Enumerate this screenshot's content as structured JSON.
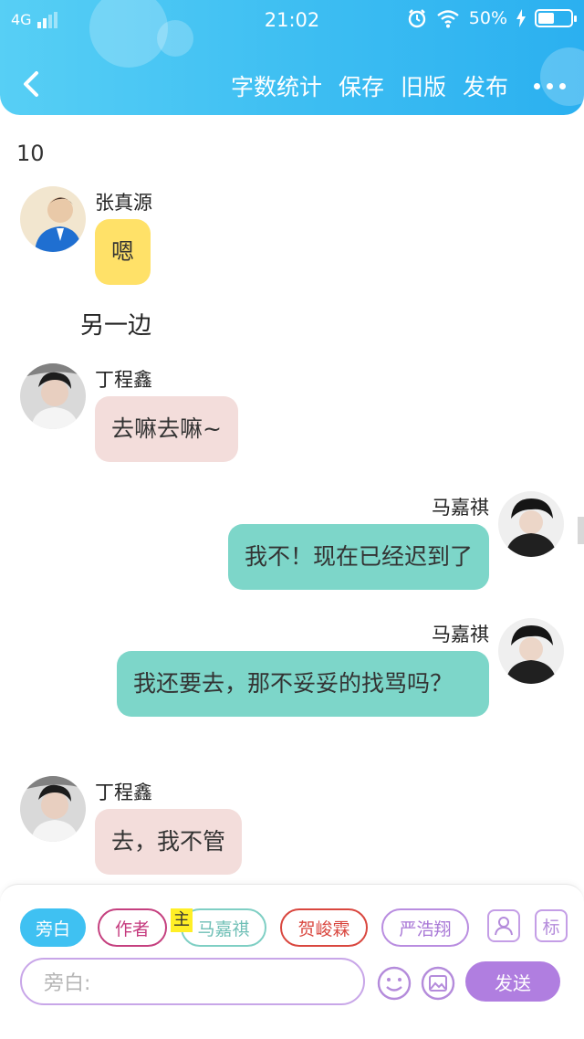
{
  "status_bar": {
    "network": "4G",
    "time": "21:02",
    "battery_percent": "50%",
    "battery_level": 0.5,
    "icons": [
      "alarm-icon",
      "wifi-icon",
      "charging-bolt-icon",
      "battery-icon"
    ]
  },
  "navbar": {
    "back_icon": "chevron-left-icon",
    "actions": [
      "字数统计",
      "保存",
      "旧版",
      "发布"
    ],
    "more_icon": "more-dots-icon"
  },
  "content": {
    "word_count": "10",
    "narration": "另一边",
    "messages": [
      {
        "side": "left",
        "name": "张真源",
        "text": "嗯",
        "color": "#ffe168"
      },
      {
        "side": "left",
        "name": "丁程鑫",
        "text": "去嘛去嘛~",
        "color": "#f3dddb"
      },
      {
        "side": "right",
        "name": "马嘉祺",
        "text": "我不！现在已经迟到了",
        "color": "#7dd6c9"
      },
      {
        "side": "right",
        "name": "马嘉祺",
        "text": "我还要去，那不妥妥的找骂吗？",
        "color": "#7dd6c9"
      },
      {
        "side": "left",
        "name": "丁程鑫",
        "text": "去，我不管",
        "color": "#f3dddb"
      }
    ]
  },
  "bottom": {
    "roles": [
      "旁白",
      "作者",
      "马嘉祺",
      "贺峻霖",
      "严浩翔"
    ],
    "lead_tag": "主",
    "mark_button": "标",
    "input_placeholder": "旁白:",
    "send_label": "发送",
    "colors": {
      "accent": "#b07ee0",
      "narration": "#3fc1f2"
    }
  }
}
